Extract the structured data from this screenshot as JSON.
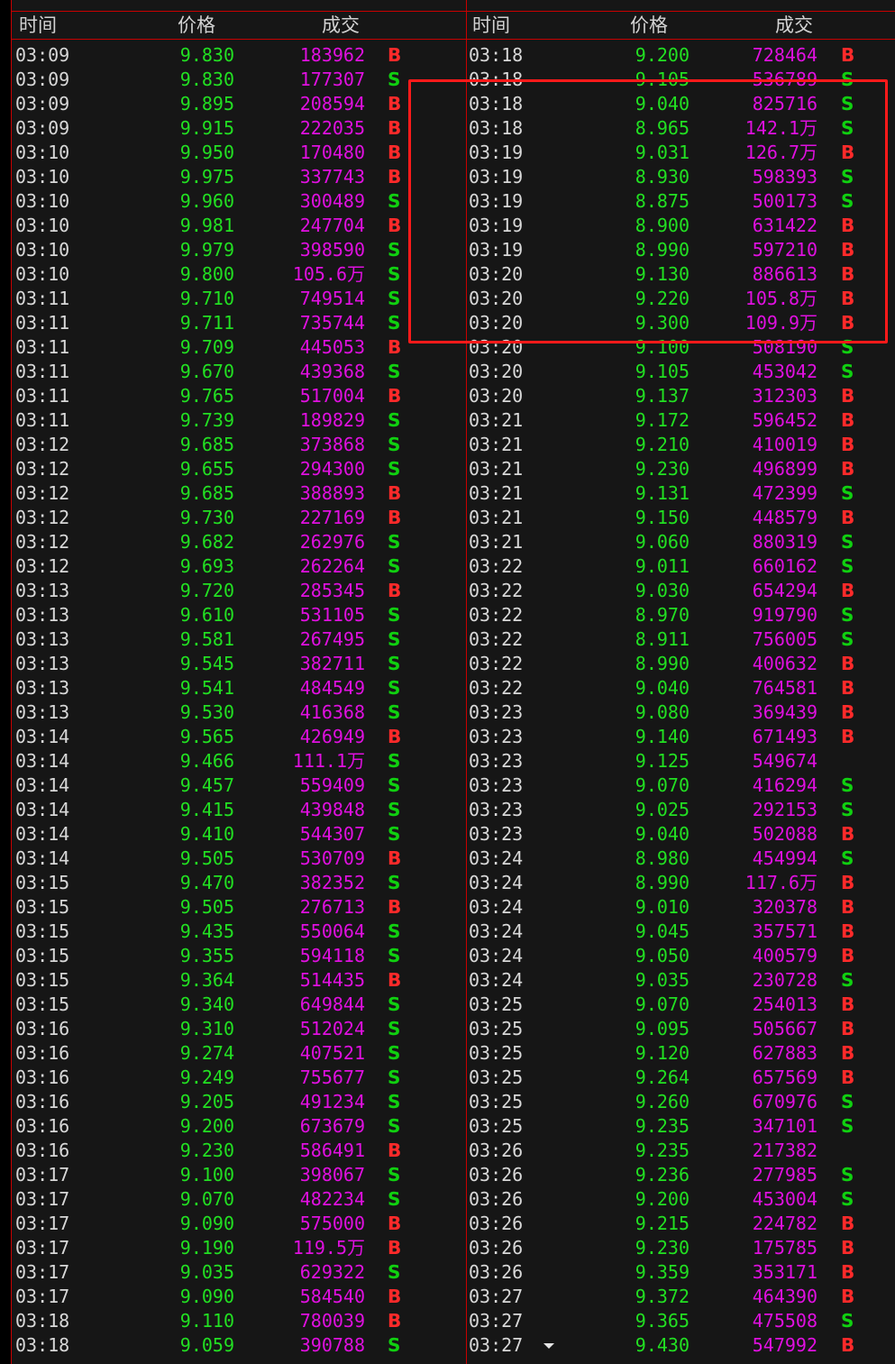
{
  "headers": {
    "time": "时间",
    "price": "价格",
    "volume": "成交"
  },
  "colors": {
    "background": "#161616",
    "grid_line": "#c80000",
    "time_text": "#d8d8d8",
    "price_text": "#22e022",
    "volume_text": "#e010e0",
    "buy_flag": "#ff2a2a",
    "sell_flag": "#10d010",
    "highlight_box": "#ff1a1a"
  },
  "icons": {
    "scroll_arrow": "triangle-down-icon"
  },
  "left_rows": [
    [
      "03:09",
      "9.830",
      "183962",
      "B"
    ],
    [
      "03:09",
      "9.830",
      "177307",
      "S"
    ],
    [
      "03:09",
      "9.895",
      "208594",
      "B"
    ],
    [
      "03:09",
      "9.915",
      "222035",
      "B"
    ],
    [
      "03:10",
      "9.950",
      "170480",
      "B"
    ],
    [
      "03:10",
      "9.975",
      "337743",
      "B"
    ],
    [
      "03:10",
      "9.960",
      "300489",
      "S"
    ],
    [
      "03:10",
      "9.981",
      "247704",
      "B"
    ],
    [
      "03:10",
      "9.979",
      "398590",
      "S"
    ],
    [
      "03:10",
      "9.800",
      "105.6万",
      "S"
    ],
    [
      "03:11",
      "9.710",
      "749514",
      "S"
    ],
    [
      "03:11",
      "9.711",
      "735744",
      "S"
    ],
    [
      "03:11",
      "9.709",
      "445053",
      "B"
    ],
    [
      "03:11",
      "9.670",
      "439368",
      "S"
    ],
    [
      "03:11",
      "9.765",
      "517004",
      "B"
    ],
    [
      "03:11",
      "9.739",
      "189829",
      "S"
    ],
    [
      "03:12",
      "9.685",
      "373868",
      "S"
    ],
    [
      "03:12",
      "9.655",
      "294300",
      "S"
    ],
    [
      "03:12",
      "9.685",
      "388893",
      "B"
    ],
    [
      "03:12",
      "9.730",
      "227169",
      "B"
    ],
    [
      "03:12",
      "9.682",
      "262976",
      "S"
    ],
    [
      "03:12",
      "9.693",
      "262264",
      "S"
    ],
    [
      "03:13",
      "9.720",
      "285345",
      "B"
    ],
    [
      "03:13",
      "9.610",
      "531105",
      "S"
    ],
    [
      "03:13",
      "9.581",
      "267495",
      "S"
    ],
    [
      "03:13",
      "9.545",
      "382711",
      "S"
    ],
    [
      "03:13",
      "9.541",
      "484549",
      "S"
    ],
    [
      "03:13",
      "9.530",
      "416368",
      "S"
    ],
    [
      "03:14",
      "9.565",
      "426949",
      "B"
    ],
    [
      "03:14",
      "9.466",
      "111.1万",
      "S"
    ],
    [
      "03:14",
      "9.457",
      "559409",
      "S"
    ],
    [
      "03:14",
      "9.415",
      "439848",
      "S"
    ],
    [
      "03:14",
      "9.410",
      "544307",
      "S"
    ],
    [
      "03:14",
      "9.505",
      "530709",
      "B"
    ],
    [
      "03:15",
      "9.470",
      "382352",
      "S"
    ],
    [
      "03:15",
      "9.505",
      "276713",
      "B"
    ],
    [
      "03:15",
      "9.435",
      "550064",
      "S"
    ],
    [
      "03:15",
      "9.355",
      "594118",
      "S"
    ],
    [
      "03:15",
      "9.364",
      "514435",
      "B"
    ],
    [
      "03:15",
      "9.340",
      "649844",
      "S"
    ],
    [
      "03:16",
      "9.310",
      "512024",
      "S"
    ],
    [
      "03:16",
      "9.274",
      "407521",
      "S"
    ],
    [
      "03:16",
      "9.249",
      "755677",
      "S"
    ],
    [
      "03:16",
      "9.205",
      "491234",
      "S"
    ],
    [
      "03:16",
      "9.200",
      "673679",
      "S"
    ],
    [
      "03:16",
      "9.230",
      "586491",
      "B"
    ],
    [
      "03:17",
      "9.100",
      "398067",
      "S"
    ],
    [
      "03:17",
      "9.070",
      "482234",
      "S"
    ],
    [
      "03:17",
      "9.090",
      "575000",
      "B"
    ],
    [
      "03:17",
      "9.190",
      "119.5万",
      "B"
    ],
    [
      "03:17",
      "9.035",
      "629322",
      "S"
    ],
    [
      "03:17",
      "9.090",
      "584540",
      "B"
    ],
    [
      "03:18",
      "9.110",
      "780039",
      "B"
    ],
    [
      "03:18",
      "9.059",
      "390788",
      "S"
    ]
  ],
  "right_rows": [
    [
      "03:18",
      "9.200",
      "728464",
      "B"
    ],
    [
      "03:18",
      "9.105",
      "536789",
      "S"
    ],
    [
      "03:18",
      "9.040",
      "825716",
      "S"
    ],
    [
      "03:18",
      "8.965",
      "142.1万",
      "S"
    ],
    [
      "03:19",
      "9.031",
      "126.7万",
      "B"
    ],
    [
      "03:19",
      "8.930",
      "598393",
      "S"
    ],
    [
      "03:19",
      "8.875",
      "500173",
      "S"
    ],
    [
      "03:19",
      "8.900",
      "631422",
      "B"
    ],
    [
      "03:19",
      "8.990",
      "597210",
      "B"
    ],
    [
      "03:20",
      "9.130",
      "886613",
      "B"
    ],
    [
      "03:20",
      "9.220",
      "105.8万",
      "B"
    ],
    [
      "03:20",
      "9.300",
      "109.9万",
      "B"
    ],
    [
      "03:20",
      "9.100",
      "508190",
      "S"
    ],
    [
      "03:20",
      "9.105",
      "453042",
      "S"
    ],
    [
      "03:20",
      "9.137",
      "312303",
      "B"
    ],
    [
      "03:21",
      "9.172",
      "596452",
      "B"
    ],
    [
      "03:21",
      "9.210",
      "410019",
      "B"
    ],
    [
      "03:21",
      "9.230",
      "496899",
      "B"
    ],
    [
      "03:21",
      "9.131",
      "472399",
      "S"
    ],
    [
      "03:21",
      "9.150",
      "448579",
      "B"
    ],
    [
      "03:21",
      "9.060",
      "880319",
      "S"
    ],
    [
      "03:22",
      "9.011",
      "660162",
      "S"
    ],
    [
      "03:22",
      "9.030",
      "654294",
      "B"
    ],
    [
      "03:22",
      "8.970",
      "919790",
      "S"
    ],
    [
      "03:22",
      "8.911",
      "756005",
      "S"
    ],
    [
      "03:22",
      "8.990",
      "400632",
      "B"
    ],
    [
      "03:22",
      "9.040",
      "764581",
      "B"
    ],
    [
      "03:23",
      "9.080",
      "369439",
      "B"
    ],
    [
      "03:23",
      "9.140",
      "671493",
      "B"
    ],
    [
      "03:23",
      "9.125",
      "549674",
      ""
    ],
    [
      "03:23",
      "9.070",
      "416294",
      "S"
    ],
    [
      "03:23",
      "9.025",
      "292153",
      "S"
    ],
    [
      "03:23",
      "9.040",
      "502088",
      "B"
    ],
    [
      "03:24",
      "8.980",
      "454994",
      "S"
    ],
    [
      "03:24",
      "8.990",
      "117.6万",
      "B"
    ],
    [
      "03:24",
      "9.010",
      "320378",
      "B"
    ],
    [
      "03:24",
      "9.045",
      "357571",
      "B"
    ],
    [
      "03:24",
      "9.050",
      "400579",
      "B"
    ],
    [
      "03:24",
      "9.035",
      "230728",
      "S"
    ],
    [
      "03:25",
      "9.070",
      "254013",
      "B"
    ],
    [
      "03:25",
      "9.095",
      "505667",
      "B"
    ],
    [
      "03:25",
      "9.120",
      "627883",
      "B"
    ],
    [
      "03:25",
      "9.264",
      "657569",
      "B"
    ],
    [
      "03:25",
      "9.260",
      "670976",
      "S"
    ],
    [
      "03:25",
      "9.235",
      "347101",
      "S"
    ],
    [
      "03:26",
      "9.235",
      "217382",
      ""
    ],
    [
      "03:26",
      "9.236",
      "277985",
      "S"
    ],
    [
      "03:26",
      "9.200",
      "453004",
      "S"
    ],
    [
      "03:26",
      "9.215",
      "224782",
      "B"
    ],
    [
      "03:26",
      "9.230",
      "175785",
      "B"
    ],
    [
      "03:26",
      "9.359",
      "353171",
      "B"
    ],
    [
      "03:27",
      "9.372",
      "464390",
      "B"
    ],
    [
      "03:27",
      "9.365",
      "475508",
      "S"
    ],
    [
      "03:27",
      "9.430",
      "547992",
      "B"
    ]
  ]
}
